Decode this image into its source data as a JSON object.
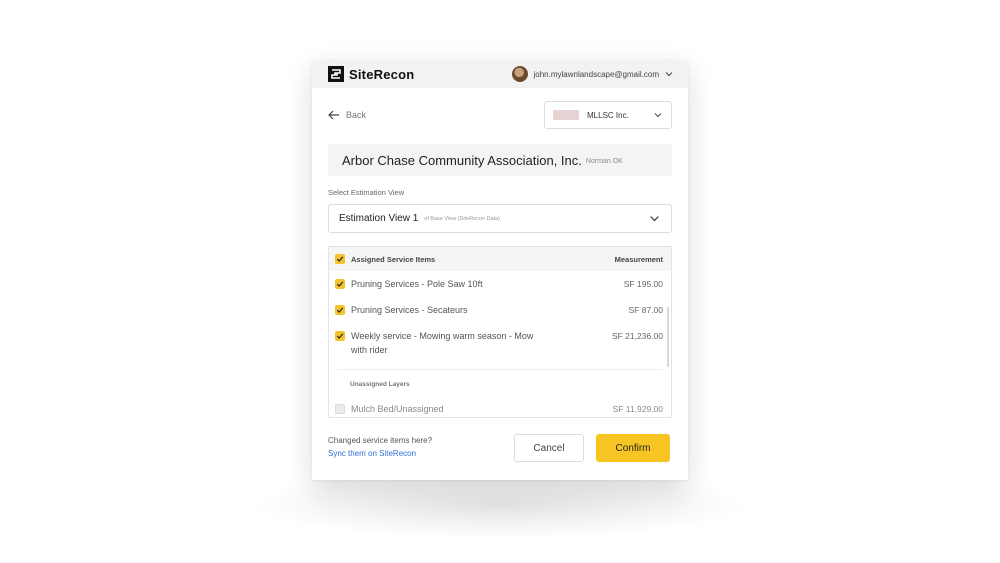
{
  "header": {
    "brand": "SiteRecon",
    "user_email": "john.mylawnlandscape@gmail.com"
  },
  "nav": {
    "back_label": "Back",
    "company": "MLLSC Inc."
  },
  "property": {
    "name": "Arbor Chase Community Association, Inc.",
    "city": "Norman OK"
  },
  "estimation": {
    "label": "Select Estimation View",
    "selected": "Estimation View 1",
    "subtitle": "of Base View (SiteRecon Data)"
  },
  "service_items": {
    "header_label": "Assigned Service Items",
    "header_measurement": "Measurement",
    "assigned": [
      {
        "name": "Pruning Services - Pole Saw 10ft",
        "measurement": "SF 195.00",
        "checked": true
      },
      {
        "name": "Pruning Services - Secateurs",
        "measurement": "SF 87.00",
        "checked": true
      },
      {
        "name": "Weekly service - Mowing warm season - Mow with rider",
        "measurement": "SF 21,236.00",
        "checked": true
      }
    ],
    "unassigned_label": "Unassigned Layers",
    "unassigned": [
      {
        "name": "Mulch Bed/Unassigned",
        "measurement": "SF 11,929.00",
        "checked": false
      }
    ]
  },
  "footer": {
    "changed_text": "Changed service items here?",
    "sync_link": "Sync them on SiteRecon",
    "cancel_label": "Cancel",
    "confirm_label": "Confirm"
  },
  "colors": {
    "accent": "#f6c523",
    "link": "#2f6fd6"
  }
}
